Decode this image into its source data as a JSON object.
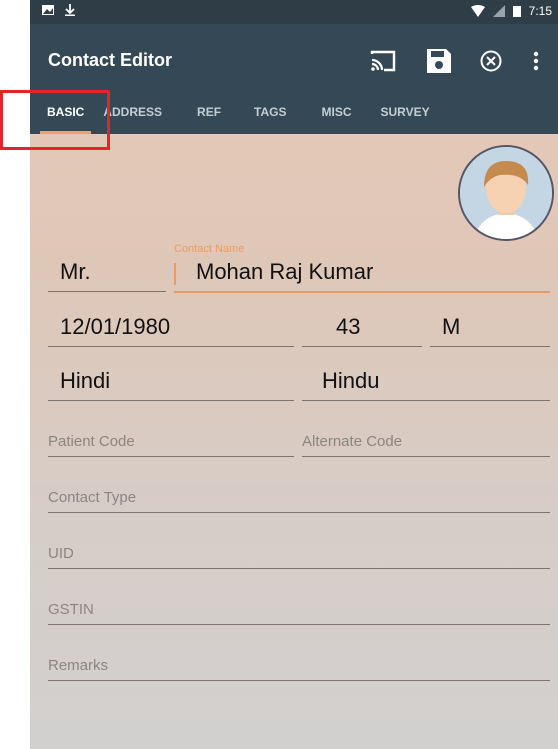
{
  "statusbar": {
    "time": "7:15"
  },
  "toolbar": {
    "title": "Contact Editor"
  },
  "tabs": [
    {
      "label": "BASIC"
    },
    {
      "label": "ADDRESS"
    },
    {
      "label": "REF"
    },
    {
      "label": "TAGS"
    },
    {
      "label": "MISC"
    },
    {
      "label": "SURVEY"
    }
  ],
  "form": {
    "salutation": "Mr.",
    "contact_name_label": "Contact Name",
    "contact_name": "Mohan Raj Kumar",
    "dob": "12/01/1980",
    "age": "43",
    "gender": "M",
    "language": "Hindi",
    "religion": "Hindu",
    "patient_code_placeholder": "Patient Code",
    "alternate_code_placeholder": "Alternate Code",
    "contact_type_placeholder": "Contact Type",
    "uid_placeholder": "UID",
    "gstin_placeholder": "GSTIN",
    "remarks_placeholder": "Remarks"
  },
  "colors": {
    "appbar": "#344955",
    "accent": "#ef9b5c",
    "highlight": "#e5242a"
  }
}
